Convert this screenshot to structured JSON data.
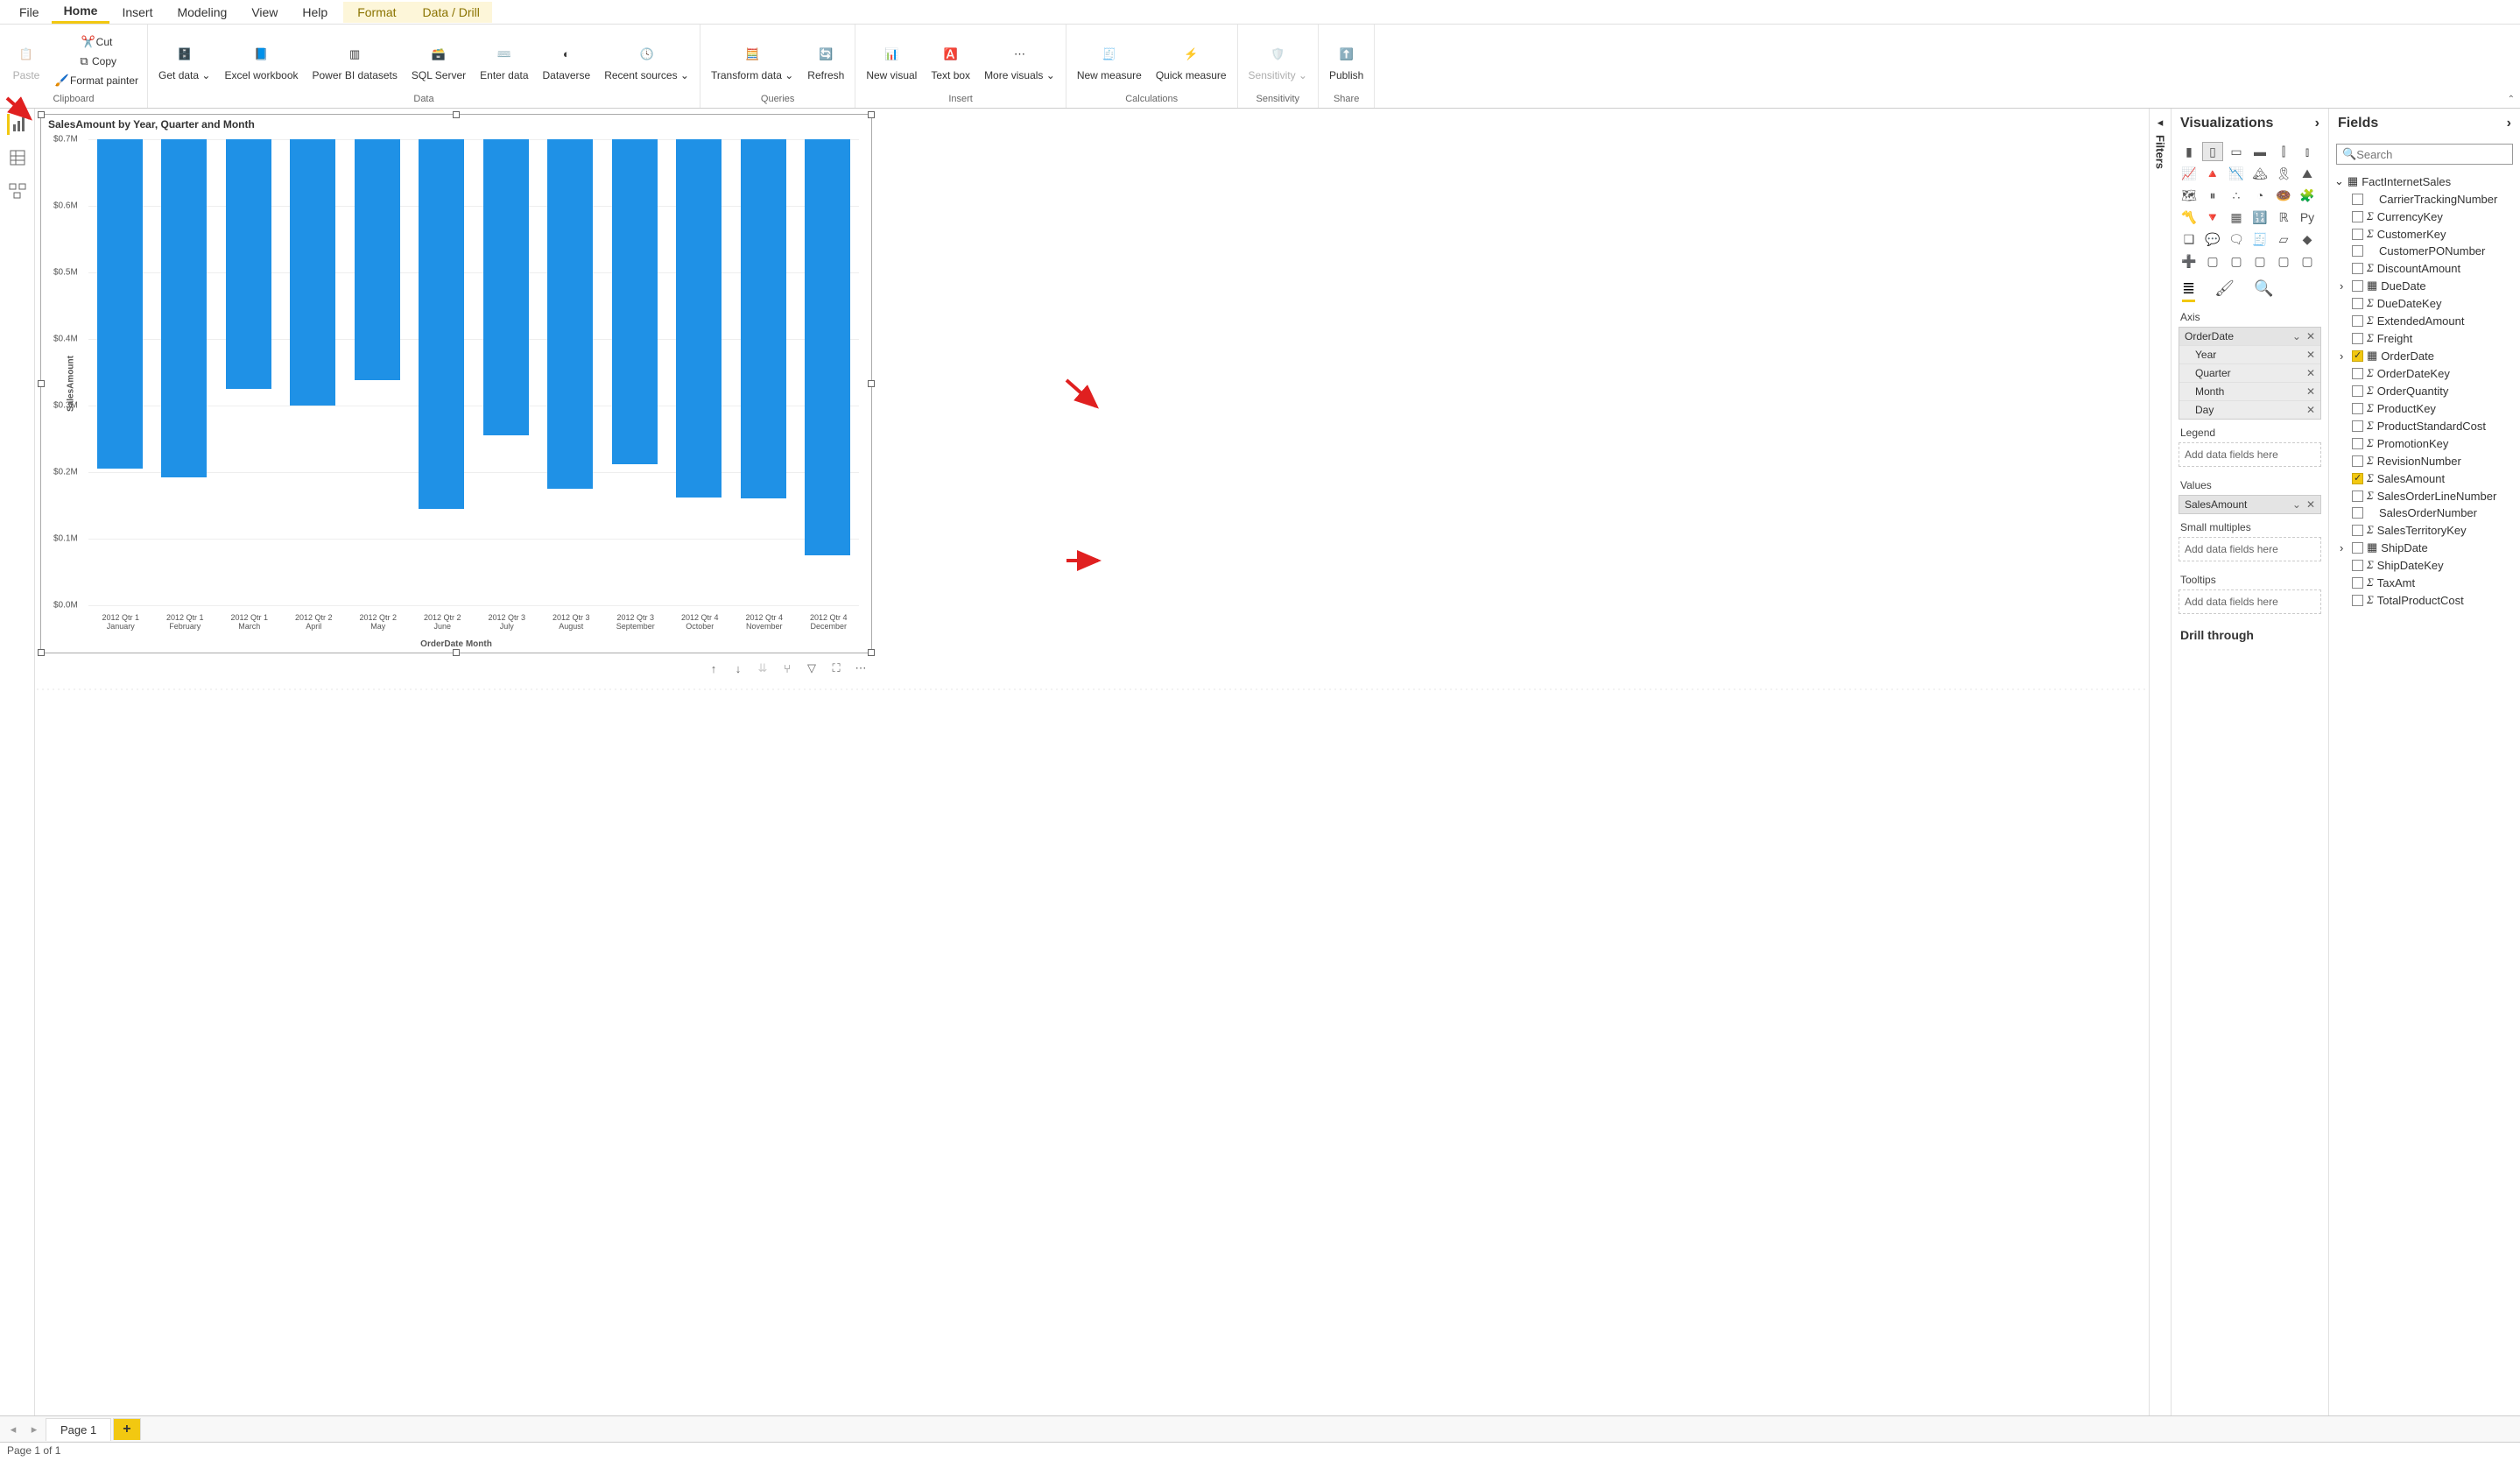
{
  "menu": {
    "file": "File",
    "home": "Home",
    "insert": "Insert",
    "modeling": "Modeling",
    "view": "View",
    "help": "Help",
    "format": "Format",
    "datadrill": "Data / Drill"
  },
  "ribbon": {
    "clipboard": {
      "label": "Clipboard",
      "paste": "Paste",
      "cut": "Cut",
      "copy": "Copy",
      "fmt": "Format painter"
    },
    "data": {
      "label": "Data",
      "get": "Get data",
      "excel": "Excel workbook",
      "pbids": "Power BI datasets",
      "sql": "SQL Server",
      "enter": "Enter data",
      "dataverse": "Dataverse",
      "recent": "Recent sources"
    },
    "queries": {
      "label": "Queries",
      "transform": "Transform data",
      "refresh": "Refresh"
    },
    "insert": {
      "label": "Insert",
      "newvis": "New visual",
      "textbox": "Text box",
      "more": "More visuals"
    },
    "calc": {
      "label": "Calculations",
      "newm": "New measure",
      "quick": "Quick measure"
    },
    "sens": {
      "label": "Sensitivity",
      "btn": "Sensitivity"
    },
    "share": {
      "label": "Share",
      "publish": "Publish"
    }
  },
  "chart_data": {
    "type": "bar",
    "title": "SalesAmount by Year, Quarter and Month",
    "ylabel": "SalesAmount",
    "xlabel": "OrderDate Month",
    "ylim": [
      0,
      0.7
    ],
    "yticks": [
      "$0.0M",
      "$0.1M",
      "$0.2M",
      "$0.3M",
      "$0.4M",
      "$0.5M",
      "$0.6M",
      "$0.7M"
    ],
    "categories": [
      "2012 Qtr 1 January",
      "2012 Qtr 1 February",
      "2012 Qtr 1 March",
      "2012 Qtr 2 April",
      "2012 Qtr 2 May",
      "2012 Qtr 2 June",
      "2012 Qtr 3 July",
      "2012 Qtr 3 August",
      "2012 Qtr 3 September",
      "2012 Qtr 4 October",
      "2012 Qtr 4 November",
      "2012 Qtr 4 December"
    ],
    "values": [
      0.495,
      0.508,
      0.375,
      0.4,
      0.362,
      0.555,
      0.445,
      0.525,
      0.488,
      0.538,
      0.54,
      0.625
    ]
  },
  "filters_label": "Filters",
  "viz": {
    "title": "Visualizations",
    "tabs": {
      "fields": "≣",
      "format": "🖌",
      "analytics": "🔍"
    },
    "axis": "Axis",
    "axis_field": "OrderDate",
    "axis_children": [
      "Year",
      "Quarter",
      "Month",
      "Day"
    ],
    "legend": "Legend",
    "values": "Values",
    "values_field": "SalesAmount",
    "small": "Small multiples",
    "tooltips": "Tooltips",
    "drop": "Add data fields here",
    "drill": "Drill through"
  },
  "fields": {
    "title": "Fields",
    "search": "Search",
    "table": "FactInternetSales",
    "items": [
      {
        "name": "CarrierTrackingNumber",
        "sig": false
      },
      {
        "name": "CurrencyKey",
        "sig": true
      },
      {
        "name": "CustomerKey",
        "sig": true
      },
      {
        "name": "CustomerPONumber",
        "sig": false
      },
      {
        "name": "DiscountAmount",
        "sig": true
      },
      {
        "name": "DueDate",
        "hier": true,
        "chev": true
      },
      {
        "name": "DueDateKey",
        "sig": true
      },
      {
        "name": "ExtendedAmount",
        "sig": true
      },
      {
        "name": "Freight",
        "sig": true
      },
      {
        "name": "OrderDate",
        "hier": true,
        "chev": true,
        "checked": true
      },
      {
        "name": "OrderDateKey",
        "sig": true
      },
      {
        "name": "OrderQuantity",
        "sig": true
      },
      {
        "name": "ProductKey",
        "sig": true
      },
      {
        "name": "ProductStandardCost",
        "sig": true
      },
      {
        "name": "PromotionKey",
        "sig": true
      },
      {
        "name": "RevisionNumber",
        "sig": true
      },
      {
        "name": "SalesAmount",
        "sig": true,
        "checked": true
      },
      {
        "name": "SalesOrderLineNumber",
        "sig": true
      },
      {
        "name": "SalesOrderNumber",
        "sig": false
      },
      {
        "name": "SalesTerritoryKey",
        "sig": true
      },
      {
        "name": "ShipDate",
        "hier": true,
        "chev": true
      },
      {
        "name": "ShipDateKey",
        "sig": true
      },
      {
        "name": "TaxAmt",
        "sig": true
      },
      {
        "name": "TotalProductCost",
        "sig": true
      }
    ]
  },
  "pages": {
    "p1": "Page 1"
  },
  "status": "Page 1 of 1"
}
